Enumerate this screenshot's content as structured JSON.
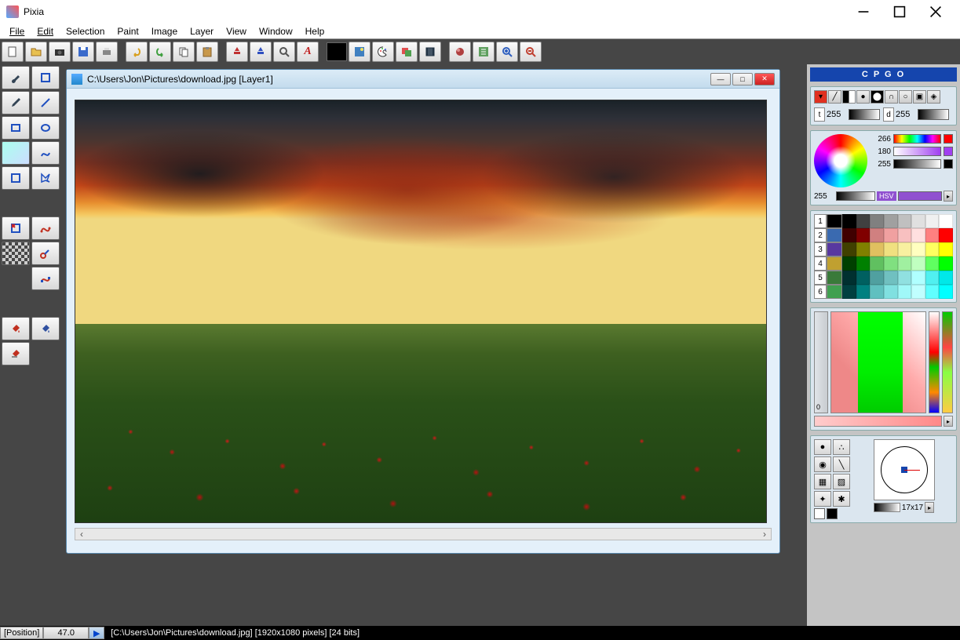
{
  "app": {
    "title": "Pixia"
  },
  "menu": {
    "file": "File",
    "edit": "Edit",
    "selection": "Selection",
    "paint": "Paint",
    "image": "Image",
    "layer": "Layer",
    "view": "View",
    "window": "Window",
    "help": "Help"
  },
  "document": {
    "title": "C:\\Users\\Jon\\Pictures\\download.jpg  [Layer1]",
    "path": "[C:\\Users\\Jon\\Pictures\\download.jpg]",
    "dimensions": "[1920x1080 pixels]",
    "bits": "[24 bits]"
  },
  "status": {
    "position_label": "[Position]",
    "value": "47.0"
  },
  "right": {
    "cpgo": "C P G O",
    "t_label": "t",
    "t_value": "255",
    "d_label": "d",
    "d_value": "255",
    "hue1": "266",
    "hue2": "180",
    "hue3": "255",
    "hsv_val": "255",
    "hsv_label": "HSV",
    "palette_nums": [
      "1",
      "2",
      "3",
      "4",
      "5",
      "6"
    ],
    "ruler_zero": "0",
    "brush_size": "17x17"
  },
  "palette_colors": [
    [
      "#000",
      "#404040",
      "#808080",
      "#a0a0a0",
      "#c0c0c0",
      "#e0e0e0",
      "#f0f0f0",
      "#fff"
    ],
    [
      "#400000",
      "#800000",
      "#d08080",
      "#f0a0a0",
      "#f8c0c0",
      "#ffe0e0",
      "#ff8080",
      "#ff0000"
    ],
    [
      "#404000",
      "#808000",
      "#e0c060",
      "#f0e080",
      "#f8f0a0",
      "#ffffc0",
      "#ffff60",
      "#ffff00"
    ],
    [
      "#004000",
      "#008000",
      "#60c060",
      "#80e080",
      "#a0f0a0",
      "#c0ffc0",
      "#60ff60",
      "#00ff00"
    ],
    [
      "#003030",
      "#006060",
      "#50a0a0",
      "#70c0c0",
      "#90e0e0",
      "#b0ffff",
      "#50f0f0",
      "#00e8e8"
    ],
    [
      "#004040",
      "#008080",
      "#60c0c0",
      "#80e0e0",
      "#a0f8f8",
      "#c0ffff",
      "#60ffff",
      "#00ffff"
    ]
  ],
  "palette_thumbs": [
    "#000",
    "#3a6ab0",
    "#5838a0",
    "#c0a030",
    "#3a7a3a",
    "#40a050"
  ]
}
